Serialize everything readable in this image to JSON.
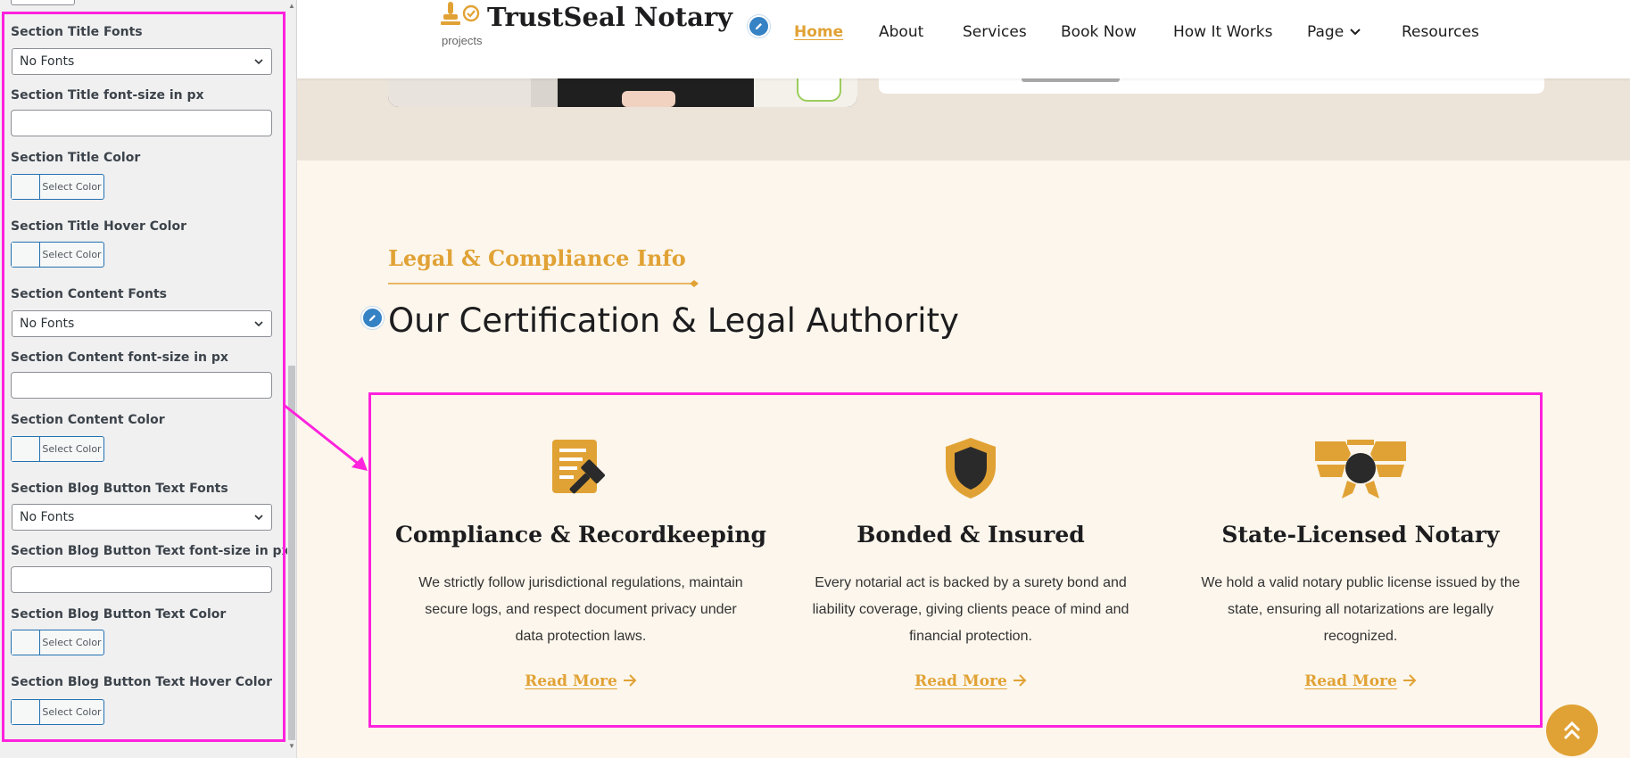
{
  "sidebar": {
    "settings": [
      {
        "label": "Section Title Fonts",
        "type": "select",
        "value": "No Fonts"
      },
      {
        "label": "Section Title font-size in px",
        "type": "input",
        "value": ""
      },
      {
        "label": "Section Title Color",
        "type": "color",
        "button": "Select Color"
      },
      {
        "label": "Section Title Hover Color",
        "type": "color",
        "button": "Select Color"
      },
      {
        "label": "Section Content Fonts",
        "type": "select",
        "value": "No Fonts"
      },
      {
        "label": "Section Content font-size in px",
        "type": "input",
        "value": ""
      },
      {
        "label": "Section Content Color",
        "type": "color",
        "button": "Select Color"
      },
      {
        "label": "Section Blog Button Text Fonts",
        "type": "select",
        "value": "No Fonts"
      },
      {
        "label": "Section Blog Button Text font-size in px",
        "type": "input",
        "value": ""
      },
      {
        "label": "Section Blog Button Text Color",
        "type": "color",
        "button": "Select Color"
      },
      {
        "label": "Section Blog Button Text Hover Color",
        "type": "color",
        "button": "Select Color"
      }
    ]
  },
  "header": {
    "brand": "TrustSeal Notary",
    "tagline": "projects",
    "nav": [
      {
        "label": "Home",
        "active": true
      },
      {
        "label": "About"
      },
      {
        "label": "Services"
      },
      {
        "label": "Book Now"
      },
      {
        "label": "How It Works"
      },
      {
        "label": "Page",
        "dropdown": true
      },
      {
        "label": "Resources"
      }
    ]
  },
  "section": {
    "eyebrow": "Legal & Compliance Info",
    "title": "Our Certification & Legal Authority",
    "features": [
      {
        "icon": "document-gavel-icon",
        "title": "Compliance & Recordkeeping",
        "text": "We strictly follow jurisdictional regulations, maintain secure logs, and respect document privacy under data protection laws.",
        "link": "Read More"
      },
      {
        "icon": "shield-icon",
        "title": "Bonded & Insured",
        "text": "Every notarial act is backed by a surety bond and liability coverage, giving clients peace of mind and financial protection.",
        "link": "Read More"
      },
      {
        "icon": "certificate-ribbon-icon",
        "title": "State-Licensed Notary",
        "text": "We hold a valid notary public license issued by the state, ensuring all notarizations are legally recognized.",
        "link": "Read More"
      }
    ]
  },
  "colors": {
    "accent": "#e1a235",
    "highlight": "#ff22dd",
    "edit": "#3582c4",
    "section_bg": "#fcf6ec"
  }
}
